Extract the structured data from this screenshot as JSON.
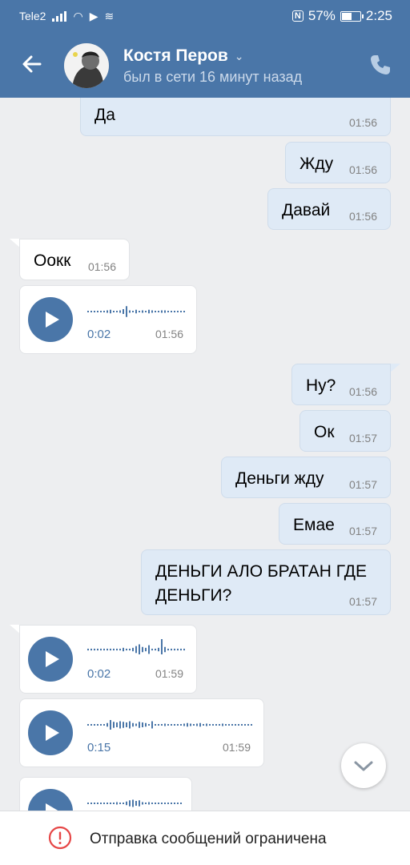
{
  "statusbar": {
    "carrier": "Tele2",
    "battery_text": "57%",
    "battery_level": 0.57,
    "time": "2:25"
  },
  "header": {
    "name": "Костя Перов",
    "status": "был в сети 16 минут назад"
  },
  "messages": [
    {
      "text": "Да",
      "time": "01:56"
    },
    {
      "text": "Жду",
      "time": "01:56"
    },
    {
      "text": "Давай",
      "time": "01:56"
    },
    {
      "text": "Оокк",
      "time": "01:56"
    },
    {
      "duration": "0:02",
      "time": "01:56"
    },
    {
      "text": "Ну?",
      "time": "01:56"
    },
    {
      "text": "Ок",
      "time": "01:57"
    },
    {
      "text": "Деньги жду",
      "time": "01:57"
    },
    {
      "text": "Емае",
      "time": "01:57"
    },
    {
      "text_line1": "ДЕНЬГИ АЛО БРАТАН ГДЕ",
      "text_line2": "ДЕНЬГИ?",
      "time": "01:57"
    },
    {
      "duration": "0:02",
      "time": "01:59"
    },
    {
      "duration": "0:15",
      "time": "01:59"
    },
    {
      "duration": "",
      "time": ""
    }
  ],
  "bottom": {
    "notice": "Отправка сообщений ограничена"
  },
  "colors": {
    "accent": "#4a76a8",
    "outgoing_bubble": "#dfeaf6",
    "incoming_bubble": "#ffffff",
    "background": "#edeef0"
  }
}
